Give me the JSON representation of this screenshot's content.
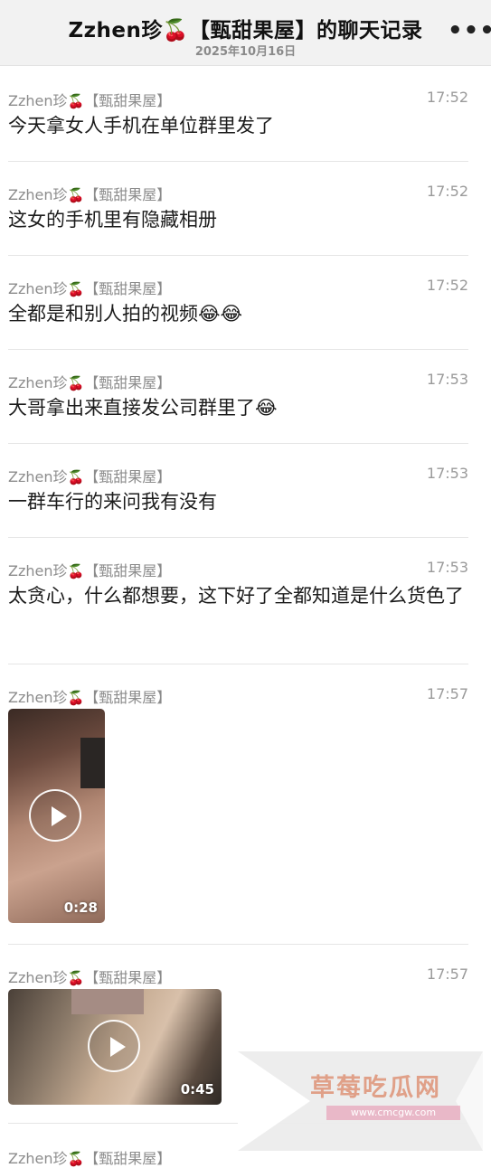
{
  "header": {
    "title": "Zzhen珍🍒【甄甜果屋】的聊天记录",
    "subtitle": "2025年10月16日",
    "more_label": "•••"
  },
  "messages": [
    {
      "sender": "Zzhen珍",
      "sender_emoji": "🍒",
      "group": "【甄甜果屋】",
      "time": "17:52",
      "text": "今天拿女人手机在单位群里发了"
    },
    {
      "sender": "Zzhen珍",
      "sender_emoji": "🍒",
      "group": "【甄甜果屋】",
      "time": "17:52",
      "text": "这女的手机里有隐藏相册"
    },
    {
      "sender": "Zzhen珍",
      "sender_emoji": "🍒",
      "group": "【甄甜果屋】",
      "time": "17:52",
      "text": "全都是和别人拍的视频😂😂"
    },
    {
      "sender": "Zzhen珍",
      "sender_emoji": "🍒",
      "group": "【甄甜果屋】",
      "time": "17:53",
      "text": "大哥拿出来直接发公司群里了😂"
    },
    {
      "sender": "Zzhen珍",
      "sender_emoji": "🍒",
      "group": "【甄甜果屋】",
      "time": "17:53",
      "text": "一群车行的来问我有没有"
    },
    {
      "sender": "Zzhen珍",
      "sender_emoji": "🍒",
      "group": "【甄甜果屋】",
      "time": "17:53",
      "text": "太贪心，什么都想要，这下好了全都知道是什么货色了"
    },
    {
      "sender": "Zzhen珍",
      "sender_emoji": "🍒",
      "group": "【甄甜果屋】",
      "time": "17:57",
      "video_duration": "0:28",
      "video_thumbnail": "blurred-video-thumbnail"
    },
    {
      "sender": "Zzhen珍",
      "sender_emoji": "🍒",
      "group": "【甄甜果屋】",
      "time": "17:57",
      "video_duration": "0:45",
      "video_thumbnail": "blurred-video-thumbnail"
    },
    {
      "sender": "Zzhen珍",
      "sender_emoji": "🍒",
      "group": "【甄甜果屋】"
    }
  ],
  "watermark": {
    "text": "草莓吃瓜网",
    "url": "www.cmcgw.com"
  },
  "icons": {
    "play": "play-icon",
    "more": "more-icon"
  },
  "colors": {
    "header_bg": "#f2f2f2",
    "sender_gray": "#8c8c8c",
    "time_gray": "#9a9a9a",
    "divider": "#e5e5e5"
  }
}
